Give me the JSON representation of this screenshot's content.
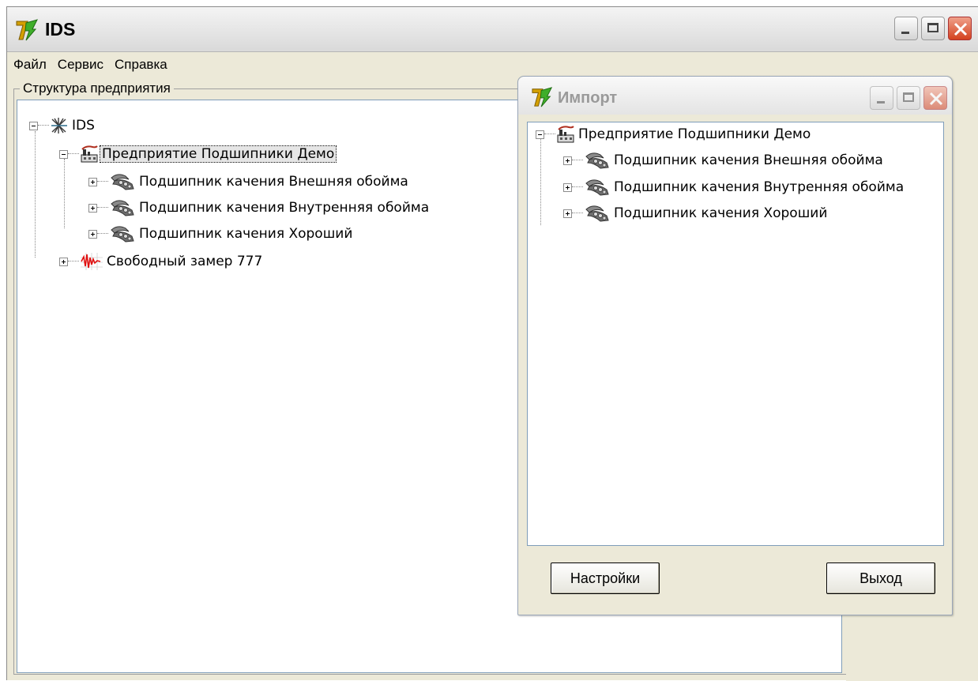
{
  "window": {
    "title": "IDS",
    "menu": [
      "Файл",
      "Сервис",
      "Справка"
    ],
    "group_label": "Структура предприятия",
    "tree": {
      "root": "IDS",
      "enterprise": "Предприятие Подшипники Демо",
      "children": [
        "Подшипник качения Внешняя обойма",
        "Подшипник качения Внутренняя обойма",
        "Подшипник качения Хороший"
      ],
      "measurement": "Свободный замер 777"
    }
  },
  "import_dialog": {
    "title": "Импорт",
    "tree": {
      "enterprise": "Предприятие Подшипники Демо",
      "children": [
        "Подшипник качения Внешняя обойма",
        "Подшипник качения Внутренняя обойма",
        "Подшипник качения Хороший"
      ]
    },
    "settings_button": "Настройки",
    "exit_button": "Выход"
  },
  "icons": {
    "app": "app-logo-icon",
    "root": "network-root-icon",
    "enterprise": "factory-icon",
    "bearing": "bearing-icon",
    "measurement": "waveform-icon"
  }
}
